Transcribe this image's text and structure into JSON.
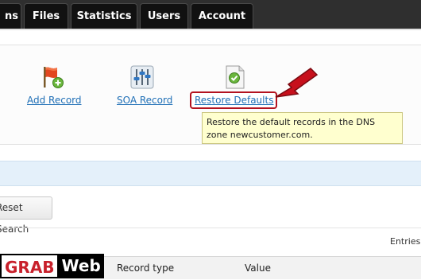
{
  "nav": {
    "tabs": [
      {
        "label": "ns"
      },
      {
        "label": "Files"
      },
      {
        "label": "Statistics"
      },
      {
        "label": "Users"
      },
      {
        "label": "Account"
      }
    ]
  },
  "toolbar": {
    "add_record": {
      "label": "Add Record",
      "icon": "flag-add-icon"
    },
    "soa_record": {
      "label": "SOA Record",
      "icon": "sliders-icon"
    },
    "restore_defaults": {
      "label": "Restore Defaults",
      "icon": "document-check-icon"
    }
  },
  "tooltip": {
    "line1": "Restore the default records in the DNS",
    "line2": "zone newcustomer.com."
  },
  "search": {
    "reset_label": "Reset Search"
  },
  "table": {
    "entries_label": "Entries",
    "columns": [
      "Record type",
      "Value"
    ]
  },
  "watermark": {
    "part1": "GRAB",
    "part2": "Web"
  },
  "colors": {
    "highlight": "#b3121f",
    "link": "#1f6fb6",
    "tooltip_bg": "#ffffcf"
  }
}
